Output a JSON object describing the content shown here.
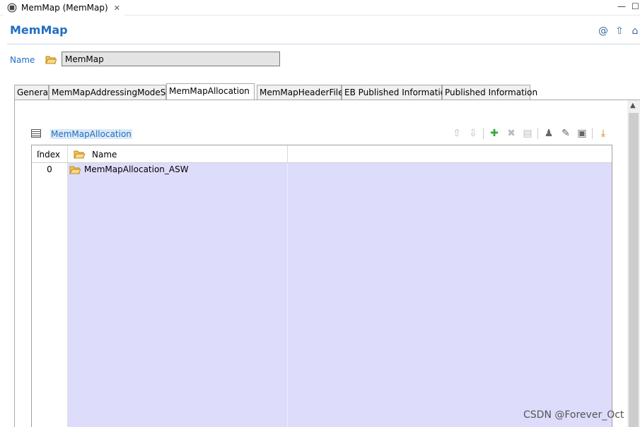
{
  "editor_tab": {
    "label": "MemMap (MemMap)",
    "close": "✕"
  },
  "window_controls": {
    "minimize": "—",
    "maximize": "☐"
  },
  "header": {
    "title": "MemMap",
    "icons": [
      "at-icon",
      "up-arrow-icon",
      "home-icon"
    ]
  },
  "name_field": {
    "label": "Name",
    "value": "MemMap"
  },
  "tabs": [
    {
      "label": "General",
      "active": false
    },
    {
      "label": "MemMapAddressingModeSet",
      "active": false
    },
    {
      "label": "MemMapAllocation",
      "active": true
    },
    {
      "label": "MemMapHeaderFiles",
      "active": false
    },
    {
      "label": "EB Published Information",
      "active": false
    },
    {
      "label": "Published Information",
      "active": false
    }
  ],
  "section": {
    "label": "MemMapAllocation"
  },
  "toolbar": {
    "items": [
      "move-up-icon",
      "move-down-icon",
      "add-icon",
      "delete-icon",
      "copy-icon",
      "user-icon",
      "edit-icon",
      "edit-table-icon",
      "import-icon"
    ]
  },
  "table": {
    "columns": [
      "Index",
      "Name"
    ],
    "rows": [
      {
        "index": "0",
        "name": "MemMapAllocation_ASW"
      }
    ],
    "empty_rows": 19
  },
  "watermark": "CSDN @Forever_Oct",
  "colors": {
    "accent": "#1f6fc2",
    "row_fill": "#dedcfb"
  }
}
